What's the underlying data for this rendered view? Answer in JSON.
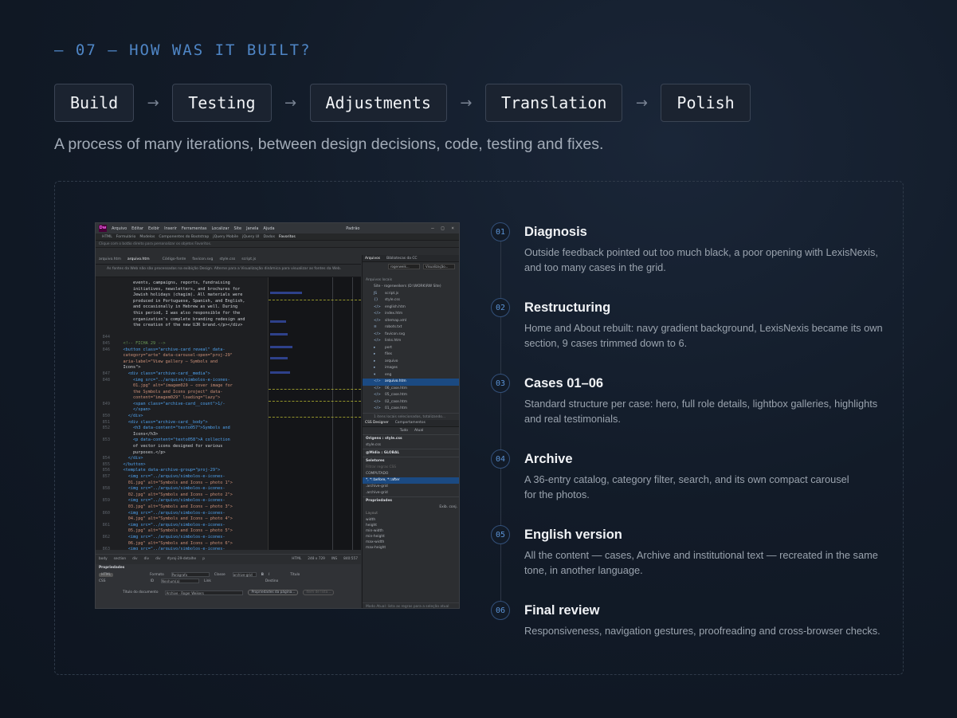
{
  "section_label": "— 07 — HOW WAS IT BUILT?",
  "steps": [
    "Build",
    "Testing",
    "Adjustments",
    "Translation",
    "Polish"
  ],
  "arrow": "→",
  "subtitle": "A process of many iterations, between design decisions, code, testing and fixes.",
  "screenshot": {
    "app_logo": "Dw",
    "menu": [
      "Arquivo",
      "Editar",
      "Exibir",
      "Inserir",
      "Ferramentas",
      "Localizar",
      "Site",
      "Janela",
      "Ajuda"
    ],
    "workspace": "Padrão",
    "insert_tabs": [
      "HTML",
      "Formulário",
      "Modelos",
      "Componentes do Bootstrap",
      "jQuery Mobile",
      "jQuery UI",
      "Dados",
      "Favoritos"
    ],
    "notice": "Clique com o botão direito para personalizar os objetos Favoritos.",
    "doc_tabs": [
      "arquivo.htm",
      "arquivo.htm"
    ],
    "related_files": [
      "Código-fonte",
      "favicon.svg",
      "style.css",
      "script.js"
    ],
    "editor_notice": "As fontes da Web não são processadas na exibição Design. Alterne para a Visualização dinâmica para visualizar as fontes da Web.",
    "code_lines": [
      {
        "n": "",
        "t": "        events, campaigns, reports, fundraising"
      },
      {
        "n": "",
        "t": "        initiatives, newsletters, and brochures for"
      },
      {
        "n": "",
        "t": "        Jewish holidays (chagim). All materials were"
      },
      {
        "n": "",
        "t": "        produced in Portuguese, Spanish, and English,"
      },
      {
        "n": "",
        "t": "        and occasionally in Hebrew as well. During"
      },
      {
        "n": "",
        "t": "        this period, I was also responsible for the"
      },
      {
        "n": "",
        "t": "        organization's complete branding redesign and"
      },
      {
        "n": "",
        "t": "        the creation of the new UJR brand.</p></div>"
      },
      {
        "n": "",
        "t": ""
      },
      {
        "n": "844",
        "t": ""
      },
      {
        "n": "845",
        "t": "    <!-- FICHA 29 -->"
      },
      {
        "n": "846",
        "t": "    <button class=\"archive-card reveal\" data-"
      },
      {
        "n": "",
        "t": "    category=\"arte\" data-carousel-open=\"proj-29\""
      },
      {
        "n": "",
        "t": "    aria-label=\"View gallery — Symbols and"
      },
      {
        "n": "",
        "t": "    Icons\">"
      },
      {
        "n": "847",
        "t": "      <div class=\"archive-card__media\">"
      },
      {
        "n": "848",
        "t": "        <img src=\"../arquivo/simbolos-e-icones-"
      },
      {
        "n": "",
        "t": "        01.jpg\" alt=\"imagem029 — cover image for"
      },
      {
        "n": "",
        "t": "        the Symbols and Icons project\" data-"
      },
      {
        "n": "",
        "t": "        content=\"imagem029\" loading=\"lazy\">"
      },
      {
        "n": "849",
        "t": "        <span class=\"archive-card__count\">1/-"
      },
      {
        "n": "",
        "t": "        </span>"
      },
      {
        "n": "850",
        "t": "      </div>"
      },
      {
        "n": "851",
        "t": "      <div class=\"archive-card__body\">"
      },
      {
        "n": "852",
        "t": "        <h3 data-content=\"texto057\">Symbols and"
      },
      {
        "n": "",
        "t": "        Icons</h3>"
      },
      {
        "n": "853",
        "t": "        <p data-content=\"texto058\">A collection"
      },
      {
        "n": "",
        "t": "        of vector icons designed for various"
      },
      {
        "n": "",
        "t": "        purposes.</p>"
      },
      {
        "n": "854",
        "t": "      </div>"
      },
      {
        "n": "855",
        "t": "    </button>"
      },
      {
        "n": "856",
        "t": "    <template data-archive-group=\"proj-29\">"
      },
      {
        "n": "857",
        "t": "      <img src=\"../arquivo/simbolos-e-icones-"
      },
      {
        "n": "",
        "t": "      01.jpg\" alt=\"Symbols and Icons — photo 1\">"
      },
      {
        "n": "858",
        "t": "      <img src=\"../arquivo/simbolos-e-icones-"
      },
      {
        "n": "",
        "t": "      02.jpg\" alt=\"Symbols and Icons — photo 2\">"
      },
      {
        "n": "859",
        "t": "      <img src=\"../arquivo/simbolos-e-icones-"
      },
      {
        "n": "",
        "t": "      03.jpg\" alt=\"Symbols and Icons — photo 3\">"
      },
      {
        "n": "860",
        "t": "      <img src=\"../arquivo/simbolos-e-icones-"
      },
      {
        "n": "",
        "t": "      04.jpg\" alt=\"Symbols and Icons — photo 4\">"
      },
      {
        "n": "861",
        "t": "      <img src=\"../arquivo/simbolos-e-icones-"
      },
      {
        "n": "",
        "t": "      05.jpg\" alt=\"Symbols and Icons — photo 5\">"
      },
      {
        "n": "862",
        "t": "      <img src=\"../arquivo/simbolos-e-icones-"
      },
      {
        "n": "",
        "t": "      06.jpg\" alt=\"Symbols and Icons — photo 6\">"
      },
      {
        "n": "863",
        "t": "      <img src=\"../arquivo/simbolos-e-icones-"
      }
    ],
    "status_tags": [
      "body",
      "section",
      "div",
      "div",
      "div",
      "#proj-29-detalhe",
      "p"
    ],
    "status_right": [
      "HTML",
      "248 x 729",
      "INS",
      "840:557"
    ],
    "properties": {
      "title": "Propriedades",
      "html_label": "HTML",
      "css_label": "CSS",
      "format_label": "Formato",
      "format_value": "Parágrafo",
      "class_label": "Classe",
      "class_value": "archive-grid",
      "id_label": "ID",
      "id_value": "Nenhum(a)",
      "link_label": "Link",
      "title_field_label": "Título",
      "target_label": "Destino",
      "doc_title_label": "Título do documento",
      "doc_title_value": "Archive · Roger Weikers",
      "page_props_button": "Propriedades da página...",
      "list_item_button": "Item de lista..."
    },
    "files_panel_tabs": [
      "Arquivos",
      "Bibliotecas da CC"
    ],
    "site_select": "rogerweik...",
    "view_select": "Visualização...",
    "local_files_label": "Arquivos locais",
    "site_root": "Site - rogerweikers (D:\\WORK\\RW Site)",
    "files": [
      {
        "icon": "JS",
        "name": "script.js"
      },
      {
        "icon": "{}",
        "name": "style.css"
      },
      {
        "icon": "</>",
        "name": "english.htm"
      },
      {
        "icon": "</>",
        "name": "index.htm"
      },
      {
        "icon": "</>",
        "name": "sitemap.xml"
      },
      {
        "icon": "≡",
        "name": "robots.txt"
      },
      {
        "icon": "</>",
        "name": "favicon.svg"
      },
      {
        "icon": "</>",
        "name": "links.htm"
      },
      {
        "icon": "▸",
        "name": "port"
      },
      {
        "icon": "▸",
        "name": "files"
      },
      {
        "icon": "▸",
        "name": "arquivo"
      },
      {
        "icon": "▸",
        "name": "images"
      },
      {
        "icon": "▾",
        "name": "eng"
      },
      {
        "icon": "</>",
        "name": "arquivo.htm",
        "selected": true
      },
      {
        "icon": "</>",
        "name": "06_case.htm"
      },
      {
        "icon": "</>",
        "name": "05_case.htm"
      },
      {
        "icon": "</>",
        "name": "02_case.htm"
      },
      {
        "icon": "</>",
        "name": "01_case.htm"
      }
    ],
    "files_status": "1 itens locais selecionados, totalizando...",
    "css_panel_tabs": [
      "CSS Designer",
      "Comportamentos"
    ],
    "css_mode_tabs": [
      "Tudo",
      "Atual"
    ],
    "sources_label": "Origens : style.css",
    "source_file": "style.css",
    "media_label": "@Mídia : GLOBAL",
    "selectors_label": "Seletores",
    "selector_filter": "Filtrar regras CSS",
    "selectors": [
      {
        "name": "COMPUTADO"
      },
      {
        "name": "*, *::before, *::after",
        "selected": true
      },
      {
        "name": ".archive-grid"
      },
      {
        "name": ".archive-grid"
      }
    ],
    "properties_label": "Propriedades",
    "show_set_label": "Exib. conj.",
    "layout_label": "Layout",
    "layout_props": [
      "width",
      "height",
      "min-width",
      "min-height",
      "max-width",
      "max-height"
    ],
    "mode_note": "Modo Atual: lista as regras para a seleção atual"
  },
  "timeline": [
    {
      "num": "01",
      "title": "Diagnosis",
      "text": "Outside feedback pointed out too much black, a poor opening with LexisNexis, and too many cases in the grid."
    },
    {
      "num": "02",
      "title": "Restructuring",
      "text": "Home and About rebuilt: navy gradient background, LexisNexis became its own section, 9 cases trimmed down to 6."
    },
    {
      "num": "03",
      "title": "Cases 01–06",
      "text": "Standard structure per case: hero, full role details, lightbox galleries, highlights and real testimonials."
    },
    {
      "num": "04",
      "title": "Archive",
      "text": "A 36-entry catalog, category filter, search, and its own compact carousel for the photos."
    },
    {
      "num": "05",
      "title": "English version",
      "text": "All the content — cases, Archive and institutional text — recreated in the same tone, in another language."
    },
    {
      "num": "06",
      "title": "Final review",
      "text": "Responsiveness, navigation gestures, proofreading and cross-browser checks."
    }
  ]
}
